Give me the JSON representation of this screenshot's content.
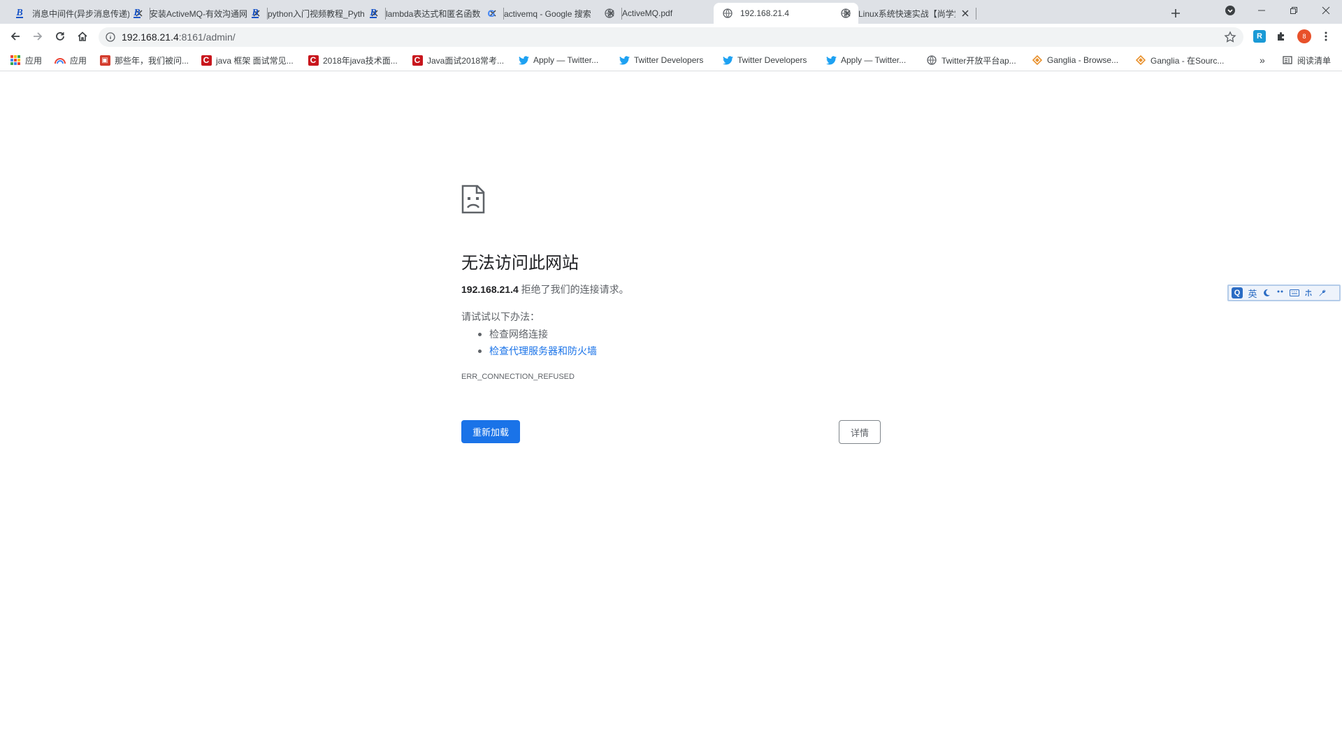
{
  "browser": {
    "tabs": [
      {
        "title": "消息中间件(异步消息传递)",
        "favicon": "csdn-icon",
        "active": false
      },
      {
        "title": "安装ActiveMQ-有效沟通网",
        "favicon": "csdn-icon",
        "active": false
      },
      {
        "title": "python入门视频教程_Python",
        "favicon": "csdn-icon",
        "active": false
      },
      {
        "title": "lambda表达式和匿名函数",
        "favicon": "csdn-icon",
        "active": false
      },
      {
        "title": "activemq - Google 搜索",
        "favicon": "google-icon",
        "active": false
      },
      {
        "title": "ActiveMQ.pdf",
        "favicon": "globe-icon",
        "active": false
      },
      {
        "title": "192.168.21.4",
        "favicon": "globe-icon",
        "active": true
      },
      {
        "title": "Linux系统快速实战【尚学堂",
        "favicon": "globe-icon",
        "active": false
      }
    ],
    "url_host": "192.168.21.4",
    "url_rest": ":8161/admin/",
    "profile_initial": "8",
    "extension_label": "R"
  },
  "bookmarks": [
    {
      "label": "应用",
      "icon": "apps-icon"
    },
    {
      "label": "应用",
      "icon": "rainbow-icon"
    },
    {
      "label": "那些年，我们被问...",
      "icon": "box-icon"
    },
    {
      "label": "java 框架 面试常见...",
      "icon": "csdn-c-icon"
    },
    {
      "label": "2018年java技术面...",
      "icon": "csdn-c-icon"
    },
    {
      "label": "Java面试2018常考...",
      "icon": "csdn-c-icon"
    },
    {
      "label": "Apply — Twitter...",
      "icon": "twitter-icon"
    },
    {
      "label": "Twitter Developers",
      "icon": "twitter-icon"
    },
    {
      "label": "Twitter Developers",
      "icon": "twitter-icon"
    },
    {
      "label": "Apply — Twitter...",
      "icon": "twitter-icon"
    },
    {
      "label": "Twitter开放平台ap...",
      "icon": "globe-icon"
    },
    {
      "label": "Ganglia - Browse...",
      "icon": "ganglia-icon"
    },
    {
      "label": "Ganglia - 在Sourc...",
      "icon": "ganglia-icon"
    }
  ],
  "bookmarks_more": "»",
  "reading_list": "阅读清单",
  "error": {
    "title": "无法访问此网站",
    "host": "192.168.21.4",
    "desc_rest": " 拒绝了我们的连接请求。",
    "try_label": "请试试以下办法：",
    "suggestions": [
      "检查网络连接",
      "检查代理服务器和防火墙"
    ],
    "code": "ERR_CONNECTION_REFUSED",
    "reload_label": "重新加载",
    "details_label": "详情"
  },
  "ime": {
    "logo": "Q",
    "mode": "英"
  },
  "colors": {
    "accent": "#1a73e8",
    "tabstrip": "#dee1e6",
    "twitter": "#1da1f2",
    "csdn": "#c8161d"
  }
}
